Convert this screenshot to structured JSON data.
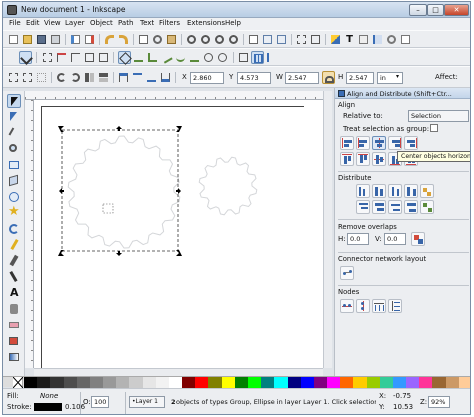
{
  "window": {
    "title": "New document 1 - Inkscape",
    "min": "–",
    "max": "□",
    "close": "✕"
  },
  "menu": [
    "File",
    "Edit",
    "View",
    "Layer",
    "Object",
    "Path",
    "Text",
    "Filters",
    "Extensions",
    "Help"
  ],
  "toolbar": {
    "x_label": "X",
    "x_value": "2.860",
    "y_label": "Y",
    "y_value": "4.573",
    "w_label": "W",
    "w_value": "2.547",
    "h_label": "H",
    "h_value": "2.547",
    "unit": "in",
    "affect": "Affect:"
  },
  "panel": {
    "title": "Align and Distribute (Shift+Ctr...",
    "align": "Align",
    "relative_to_label": "Relative to:",
    "relative_to_value": "Selection",
    "treat_as_group": "Treat selection as group:",
    "tooltip": "Center objects horizontally",
    "distribute": "Distribute",
    "remove_overlaps": "Remove overlaps",
    "h_label": "H:",
    "h_value": "0.0",
    "v_label": "V:",
    "v_value": "0.0",
    "connector": "Connector network layout",
    "nodes": "Nodes"
  },
  "status": {
    "fill_label": "Fill:",
    "fill_value": "None",
    "stroke_label": "Stroke:",
    "stroke_width": "0.106",
    "opacity_label": "O:",
    "opacity_value": "100",
    "layer": "•Layer 1",
    "message_bold": "2",
    "message": " objects of types Group, Ellipse in layer Layer 1. Click selection to",
    "x_label": "X:",
    "x_value": "-0.75",
    "y_label": "Y:",
    "y_value": "10.53",
    "z_label": "Z:",
    "z_value": "92%"
  },
  "palette_colors": [
    "#000000",
    "#1a1a1a",
    "#333333",
    "#4d4d4d",
    "#666666",
    "#808080",
    "#999999",
    "#b3b3b3",
    "#cccccc",
    "#e6e6e6",
    "#f2f2f2",
    "#ffffff",
    "#800000",
    "#ff0000",
    "#808000",
    "#ffff00",
    "#008000",
    "#00ff00",
    "#008080",
    "#00ffff",
    "#000080",
    "#0000ff",
    "#800080",
    "#ff00ff",
    "#ff6600",
    "#ffcc00",
    "#99cc00",
    "#33cc99",
    "#3399ff",
    "#9966ff",
    "#ff3399",
    "#996633",
    "#cc9966",
    "#ffcc99"
  ]
}
